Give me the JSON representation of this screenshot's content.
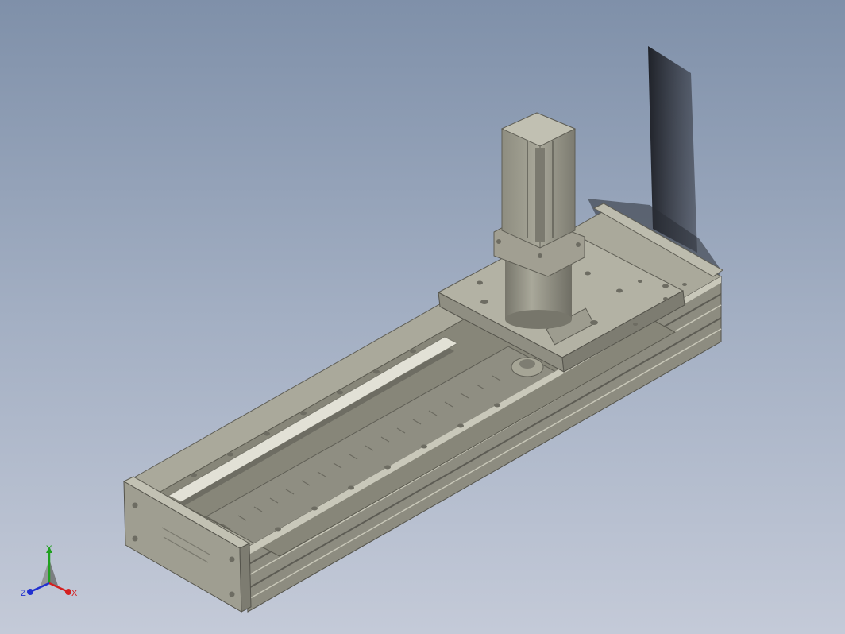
{
  "viewport": {
    "background_top": "#7f90a9",
    "background_bottom": "#c4cad8",
    "model_color": "#a6a596"
  },
  "triad": {
    "x_label": "X",
    "y_label": "Y",
    "z_label": "Z",
    "x_color": "#d42020",
    "y_color": "#1fa01f",
    "z_color": "#2030d0"
  }
}
